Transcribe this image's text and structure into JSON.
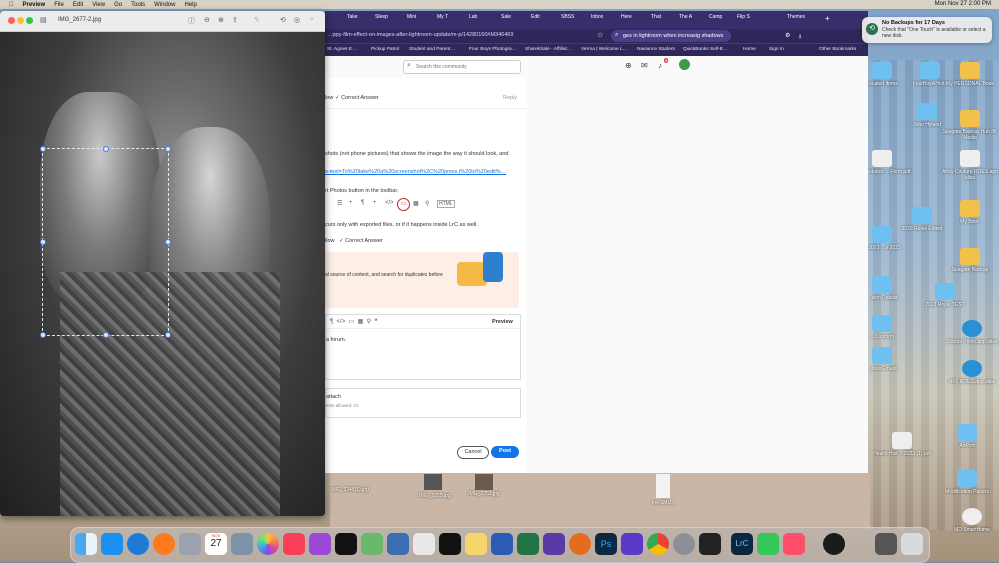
{
  "menubar": {
    "apple": "",
    "app": "Preview",
    "items": [
      "File",
      "Edit",
      "View",
      "Go",
      "Tools",
      "Window",
      "Help"
    ],
    "clock": "Mon Nov 27  2:00 PM"
  },
  "preview": {
    "title": "IMG_2677-2.jpg"
  },
  "browser": {
    "tabs": [
      "Take",
      "Sleep",
      "Mini",
      "My T",
      "Lab",
      "Sale",
      "Edit",
      "SBSS",
      "Inbox",
      "Here",
      "That",
      "The A",
      "Camp",
      "Flip S",
      "Themes"
    ],
    "address": "…ppy-film-effect-on-images-after-lightroom-update/m-p/14280160#M346469",
    "search_omnibox": "ges in lightroom when increasig shadows",
    "bookmarks": [
      "St. Agnes E…",
      "Pickup Patrol",
      "Student and Parent…",
      "Four Boys Photogra…",
      "SharekSale - Affiliat…",
      "Verma | Welcome L…",
      "Naviance Student",
      "QuickBooks Self-E…",
      "Home",
      "Sign In"
    ],
    "other_bookmarks": "Other Bookmarks",
    "community_search_placeholder": "Search this community",
    "notif_count": "5",
    "reply_row": {
      "prefix": "low",
      "correct": "Correct Answer",
      "reply": "Reply"
    },
    "lines": {
      "l1": "shots (not phone pictures) that shows the image the way it should look, and",
      "l2": "e-text=To%20take%20a%20screenshot%2C%20press.i%20to%20edit%…",
      "l3": "rt Photos button in the toolbar.",
      "l4": "curs only with exported files, or if it happens inside LrC as well.",
      "follow": "llow",
      "correct2": "Correct Answer",
      "l5": "al source of content, and search for duplicates before",
      "forum": "a forum.",
      "preview_tab": "Preview",
      "attach": "attach",
      "attach_sub": "ents allowed: 10",
      "html_tag": "HTML"
    },
    "cancel": "Cancel",
    "post": "Post"
  },
  "notification": {
    "title": "No Backups for 17 Days",
    "body": "Check that \"One Touch\" is available or select a new disk."
  },
  "desktop_icons": [
    {
      "label": "Located Items",
      "kind": "folder"
    },
    {
      "label": "FourBoysPhoto",
      "kind": "folder"
    },
    {
      "label": "My PERSONAL Book",
      "kind": "folder-y"
    },
    {
      "label": "John Hyland",
      "kind": "folder"
    },
    {
      "label": "Seagate Backup Hub 8K Media",
      "kind": "folder-y"
    },
    {
      "label": "Artsy Couture ROES.app alias",
      "kind": "doc"
    },
    {
      "label": "…Attendance …Form.pdf",
      "kind": "doc"
    },
    {
      "label": "2023 Roles Edited",
      "kind": "folder"
    },
    {
      "label": "My Book",
      "kind": "folder-y"
    },
    {
      "label": "…2023 …s 2023",
      "kind": "folder"
    },
    {
      "label": "Seagate Backup",
      "kind": "folder-y"
    },
    {
      "label": "…sion Details",
      "kind": "folder"
    },
    {
      "label": "2023 Rojas TEST",
      "kind": "folder"
    },
    {
      "label": "…Conform",
      "kind": "folder"
    },
    {
      "label": "School Prints.app alias",
      "kind": "ndoc"
    },
    {
      "label": "…otos Emails",
      "kind": "folder"
    },
    {
      "label": "NPL ROES.app alias",
      "kind": "ndoc"
    },
    {
      "label": "Health Hist… 2023 (1).pdf",
      "kind": "doc"
    },
    {
      "label": "AirPort",
      "kind": "folder"
    },
    {
      "label": "Modification Papers",
      "kind": "folder"
    },
    {
      "label": "MD SmartHome",
      "kind": "doc"
    }
  ],
  "file_thumbs": [
    "IMG_3245(1).jpg",
    "IMG_2255.jpg",
    "IMG_2253.jpg",
    "Inv SMU…"
  ],
  "dock": {
    "items": [
      "finder-icon",
      "appstore-icon",
      "safari-icon",
      "firefox-icon",
      "launchpad-icon",
      "calendar-icon",
      "photos-app-icon",
      "photos-icon",
      "music-icon",
      "podcasts-icon",
      "tv-icon",
      "maps-icon",
      "systempref-icon",
      "dropbox-icon",
      "news-icon",
      "notes-icon",
      "word-icon",
      "excel-icon",
      "imovie-icon",
      "roes-icon",
      "photoshop-icon",
      "classroom-icon",
      "chrome-icon",
      "settings-icon",
      "lr-icon",
      "lrc-icon",
      "facetime-icon",
      "creative-cloud-icon",
      "siri-icon",
      "audio-icon",
      "trash-icon"
    ],
    "calendar_day": "27",
    "calendar_month": "NOV"
  }
}
